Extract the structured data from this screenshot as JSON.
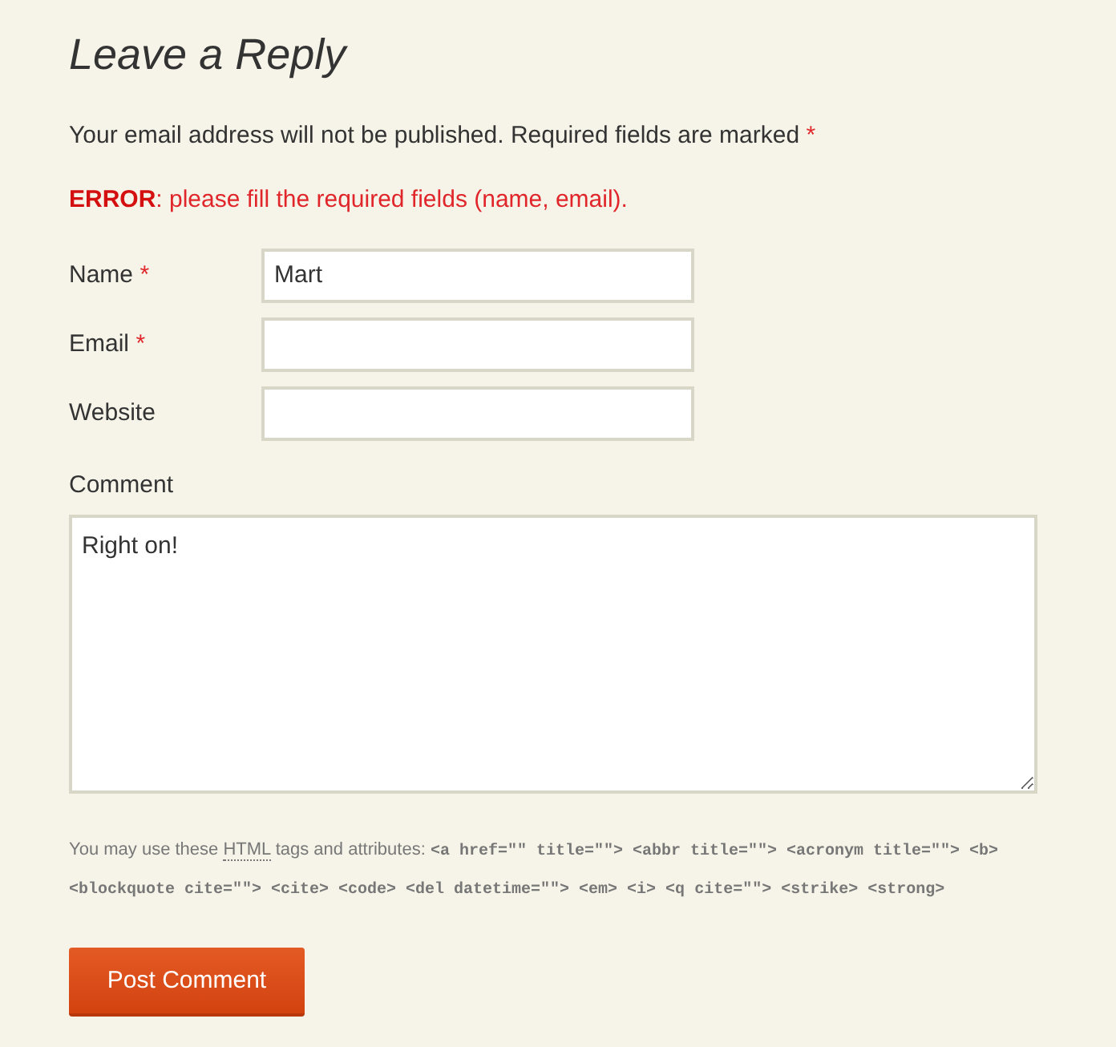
{
  "title": "Leave a Reply",
  "notice": {
    "text": "Your email address will not be published. Required fields are marked",
    "mark": "*"
  },
  "error": "**ERROR**: please fill the required fields (name, email).",
  "fields": [
    {
      "label": "Name",
      "mark": "*",
      "value": "Mart"
    },
    {
      "label": "Email",
      "mark": "*"
    },
    {
      "label": "Website"
    }
  ],
  "comment": {
    "label": "Comment",
    "value": "Right on!"
  },
  "allowed_tags": {
    "lead": "You may use these",
    "abbr": "HTML",
    "rest": "tags and attributes:",
    "code": "<a href=\"\" title=\"\"> <abbr title=\"\"> <acronym title=\"\"> <b> <blockquote cite=\"\"> <cite> <code> <del datetime=\"\"> <em> <i> <q cite=\"\"> <strike> <strong>"
  },
  "submit": "Post Comment"
}
